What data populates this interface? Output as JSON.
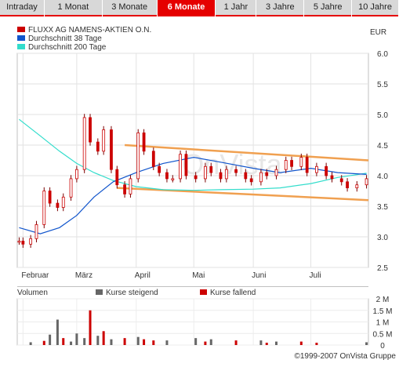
{
  "tabs": [
    {
      "label": "Intraday",
      "active": false
    },
    {
      "label": "1 Monat",
      "active": false
    },
    {
      "label": "3 Monate",
      "active": false
    },
    {
      "label": "6 Monate",
      "active": true
    },
    {
      "label": "1 Jahr",
      "active": false
    },
    {
      "label": "3 Jahre",
      "active": false
    },
    {
      "label": "5 Jahre",
      "active": false
    },
    {
      "label": "10 Jahre",
      "active": false
    }
  ],
  "legend": {
    "items": [
      {
        "label": "FLUXX AG NAMENS-AKTIEN O.N.",
        "color": "#cc0000"
      },
      {
        "label": "Durchschnitt 38 Tage",
        "color": "#1155cc"
      },
      {
        "label": "Durchschnitt 200 Tage",
        "color": "#33ddcc"
      }
    ]
  },
  "currency": "EUR",
  "watermark": "OnVista",
  "copyright": "©1999-2007 OnVista Gruppe",
  "volume_legend": {
    "title": "Volumen",
    "up": {
      "label": "Kurse steigend",
      "color": "#666666"
    },
    "down": {
      "label": "Kurse fallend",
      "color": "#cc0000"
    }
  },
  "chart_data": [
    {
      "type": "line",
      "title": "FLUXX AG NAMENS-AKTIEN O.N.",
      "x_axis": {
        "type": "time",
        "tick_labels": [
          "Februar",
          "März",
          "April",
          "Mai",
          "Juni",
          "Juli"
        ],
        "range": [
          "2007-01-29",
          "2007-07-31"
        ]
      },
      "y_axis": {
        "unit": "EUR",
        "range": [
          2.5,
          6.0
        ],
        "ticks": [
          2.5,
          3.0,
          3.5,
          4.0,
          4.5,
          5.0,
          5.5,
          6.0
        ],
        "tick_labels": [
          "2.5",
          "3.0",
          "3.5",
          "4.0",
          "4.5",
          "5.0",
          "5.5",
          "6.0"
        ],
        "grid": true
      },
      "series": [
        {
          "name": "FLUXX AG NAMENS-AKTIEN O.N.",
          "color": "#cc0000",
          "style": "candlestick",
          "x": [
            "2007-01-30",
            "2007-02-01",
            "2007-02-05",
            "2007-02-08",
            "2007-02-12",
            "2007-02-15",
            "2007-02-19",
            "2007-02-22",
            "2007-02-26",
            "2007-03-01",
            "2007-03-05",
            "2007-03-08",
            "2007-03-12",
            "2007-03-15",
            "2007-03-19",
            "2007-03-22",
            "2007-03-26",
            "2007-03-29",
            "2007-04-02",
            "2007-04-05",
            "2007-04-10",
            "2007-04-13",
            "2007-04-17",
            "2007-04-20",
            "2007-04-24",
            "2007-04-27",
            "2007-05-02",
            "2007-05-07",
            "2007-05-10",
            "2007-05-15",
            "2007-05-18",
            "2007-05-23",
            "2007-05-28",
            "2007-05-31",
            "2007-06-05",
            "2007-06-08",
            "2007-06-13",
            "2007-06-18",
            "2007-06-21",
            "2007-06-26",
            "2007-06-29",
            "2007-07-04",
            "2007-07-09",
            "2007-07-12",
            "2007-07-17",
            "2007-07-20",
            "2007-07-25",
            "2007-07-30"
          ],
          "values": [
            2.93,
            2.88,
            2.97,
            3.2,
            3.75,
            3.55,
            3.48,
            3.65,
            3.95,
            4.1,
            4.95,
            4.55,
            4.4,
            4.75,
            4.1,
            3.85,
            3.7,
            3.95,
            4.7,
            4.4,
            4.15,
            4.05,
            3.95,
            3.95,
            4.35,
            4.0,
            3.95,
            4.15,
            4.05,
            3.95,
            4.1,
            4.05,
            3.95,
            3.9,
            4.05,
            4.0,
            4.1,
            4.25,
            4.15,
            4.3,
            4.05,
            4.15,
            4.0,
            3.95,
            3.9,
            3.8,
            3.85,
            3.95
          ]
        },
        {
          "name": "Durchschnitt 38 Tage",
          "color": "#1155cc",
          "x": [
            "2007-01-30",
            "2007-02-10",
            "2007-02-20",
            "2007-03-01",
            "2007-03-10",
            "2007-03-20",
            "2007-04-01",
            "2007-04-15",
            "2007-05-01",
            "2007-05-15",
            "2007-06-01",
            "2007-06-15",
            "2007-07-01",
            "2007-07-15",
            "2007-07-30"
          ],
          "values": [
            3.15,
            3.05,
            3.15,
            3.35,
            3.65,
            3.9,
            4.05,
            4.2,
            4.3,
            4.22,
            4.12,
            4.05,
            4.12,
            4.05,
            4.02
          ]
        },
        {
          "name": "Durchschnitt 200 Tage",
          "color": "#33ddcc",
          "x": [
            "2007-01-30",
            "2007-02-10",
            "2007-02-20",
            "2007-03-01",
            "2007-03-10",
            "2007-03-20",
            "2007-04-01",
            "2007-04-15",
            "2007-05-01",
            "2007-05-15",
            "2007-06-01",
            "2007-06-15",
            "2007-07-01",
            "2007-07-15",
            "2007-07-30"
          ],
          "values": [
            4.92,
            4.65,
            4.4,
            4.2,
            4.05,
            3.92,
            3.82,
            3.77,
            3.76,
            3.77,
            3.78,
            3.8,
            3.87,
            3.97,
            4.04
          ]
        }
      ],
      "annotations": [
        {
          "type": "trend-channel",
          "color": "#f0a050",
          "upper": {
            "x": [
              "2007-03-26",
              "2007-07-31"
            ],
            "y": [
              4.5,
              4.25
            ]
          },
          "lower": {
            "x": [
              "2007-03-22",
              "2007-07-31"
            ],
            "y": [
              3.8,
              3.6
            ]
          }
        }
      ]
    },
    {
      "type": "bar",
      "title": "Volumen",
      "y_axis": {
        "range": [
          0,
          2000000
        ],
        "ticks": [
          0,
          500000,
          1000000,
          1500000,
          2000000
        ],
        "tick_labels": [
          "0",
          "0.5 M",
          "1 M",
          "1.5 M",
          "2 M"
        ]
      },
      "x_axis": {
        "type": "time",
        "range": [
          "2007-01-29",
          "2007-07-31"
        ]
      },
      "series": [
        {
          "name": "Kurse steigend",
          "color": "#666666",
          "x": [
            "2007-02-05",
            "2007-02-15",
            "2007-02-19",
            "2007-02-26",
            "2007-03-01",
            "2007-03-05",
            "2007-03-12",
            "2007-03-19",
            "2007-04-02",
            "2007-04-17",
            "2007-05-02",
            "2007-05-10",
            "2007-06-05",
            "2007-06-13",
            "2007-07-30"
          ],
          "values": [
            120000,
            450000,
            1100000,
            150000,
            500000,
            300000,
            400000,
            250000,
            350000,
            200000,
            300000,
            250000,
            200000,
            150000,
            120000
          ]
        },
        {
          "name": "Kurse fallend",
          "color": "#cc0000",
          "x": [
            "2007-02-12",
            "2007-02-22",
            "2007-03-08",
            "2007-03-15",
            "2007-03-26",
            "2007-04-05",
            "2007-04-10",
            "2007-05-07",
            "2007-05-23",
            "2007-06-08",
            "2007-06-26",
            "2007-07-04"
          ],
          "values": [
            180000,
            300000,
            1500000,
            600000,
            300000,
            250000,
            200000,
            150000,
            200000,
            100000,
            150000,
            100000
          ]
        }
      ]
    }
  ]
}
